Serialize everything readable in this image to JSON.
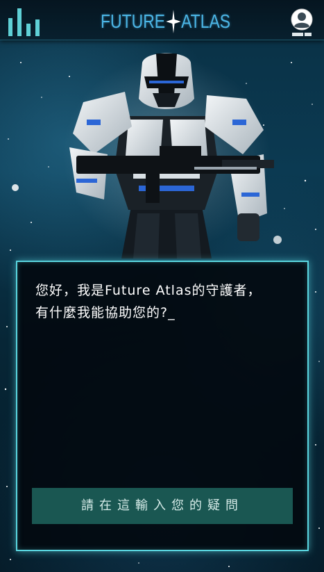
{
  "header": {
    "logo_left": "FUTURE",
    "logo_right": "ATLAS",
    "menu_icon": "bar-chart-menu-icon",
    "user_icon": "user-profile-icon"
  },
  "hero": {
    "image": "armored-soldier-with-rifle"
  },
  "chat": {
    "message": "您好，我是Future Atlas的守護者，有什麼我能協助您的?_",
    "input_placeholder": "請在這輸入您的疑問"
  },
  "colors": {
    "accent": "#5ad6e0",
    "logo": "#4bb6e6",
    "input_bg": "#1a5752",
    "panel_bg": "#030a10"
  }
}
